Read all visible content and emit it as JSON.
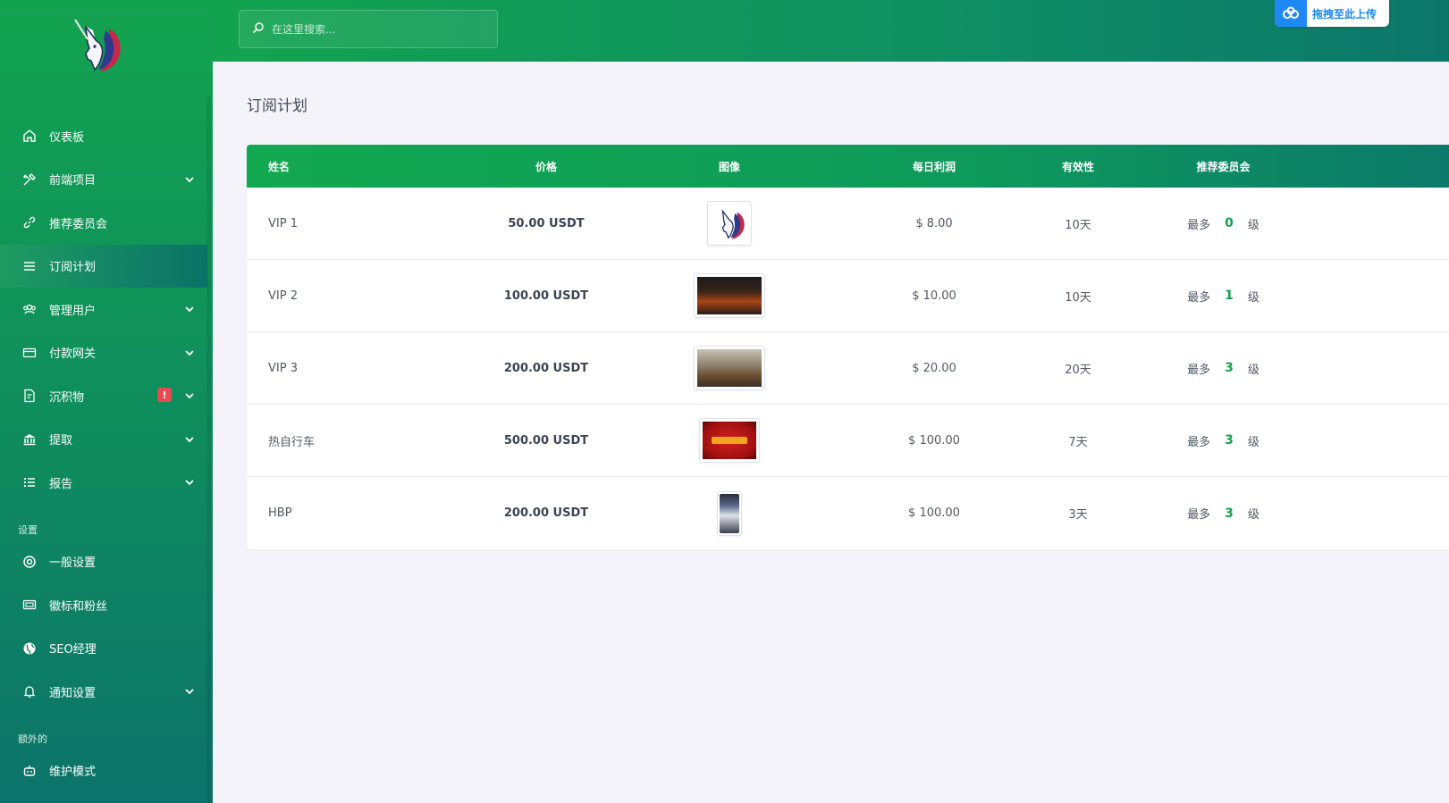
{
  "sidebar": {
    "items": [
      {
        "label": "仪表板",
        "icon": "home-icon"
      },
      {
        "label": "前端项目",
        "icon": "tools-icon"
      },
      {
        "label": "推荐委员会",
        "icon": "link-icon"
      },
      {
        "label": "订阅计划",
        "icon": "list-icon"
      },
      {
        "label": "管理用户",
        "icon": "users-icon"
      },
      {
        "label": "付款网关",
        "icon": "card-icon"
      },
      {
        "label": "沉积物",
        "icon": "deposit-icon",
        "badge": "!"
      },
      {
        "label": "提取",
        "icon": "bank-icon"
      },
      {
        "label": "报告",
        "icon": "report-list-icon"
      }
    ],
    "section_settings": "设置",
    "settings_items": [
      {
        "label": "一般设置",
        "icon": "settings-circle-icon"
      },
      {
        "label": "徽标和粉丝",
        "icon": "image-stack-icon"
      },
      {
        "label": "SEO经理",
        "icon": "globe-icon"
      },
      {
        "label": "通知设置",
        "icon": "bell-icon"
      }
    ],
    "section_extra": "额外的",
    "extra_items": [
      {
        "label": "维护模式",
        "icon": "robot-icon"
      }
    ]
  },
  "header": {
    "search_placeholder": "在这里搜索...",
    "upload_label": "拖拽至此上传"
  },
  "main": {
    "title": "订阅计划",
    "table": {
      "headers": [
        "姓名",
        "价格",
        "图像",
        "每日利润",
        "有效性",
        "推荐委员会"
      ],
      "rows": [
        {
          "name": "VIP 1",
          "price": "50.00 USDT",
          "image": "unicorn-logo",
          "profit": "$ 8.00",
          "validity": "10天",
          "ref_prefix": "最多",
          "ref_level": "0",
          "ref_suffix": "级"
        },
        {
          "name": "VIP 2",
          "price": "100.00 USDT",
          "image": "fire-scene",
          "profit": "$ 10.00",
          "validity": "10天",
          "ref_prefix": "最多",
          "ref_level": "1",
          "ref_suffix": "级"
        },
        {
          "name": "VIP 3",
          "price": "200.00 USDT",
          "image": "mining-truck",
          "profit": "$ 20.00",
          "validity": "20天",
          "ref_prefix": "最多",
          "ref_level": "3",
          "ref_suffix": "级"
        },
        {
          "name": "热自行车",
          "price": "500.00 USDT",
          "image": "hot-slot",
          "profit": "$ 100.00",
          "validity": "7天",
          "ref_prefix": "最多",
          "ref_level": "3",
          "ref_suffix": "级"
        },
        {
          "name": "HBP",
          "price": "200.00 USDT",
          "image": "phone-app",
          "profit": "$ 100.00",
          "validity": "3天",
          "ref_prefix": "最多",
          "ref_level": "3",
          "ref_suffix": "级"
        }
      ]
    }
  },
  "colors": {
    "brand_green": "#12a34f",
    "brand_teal": "#0c736a",
    "level_green": "#12a04f",
    "badge_red": "#e84a55",
    "upload_blue": "#1e88f5"
  }
}
